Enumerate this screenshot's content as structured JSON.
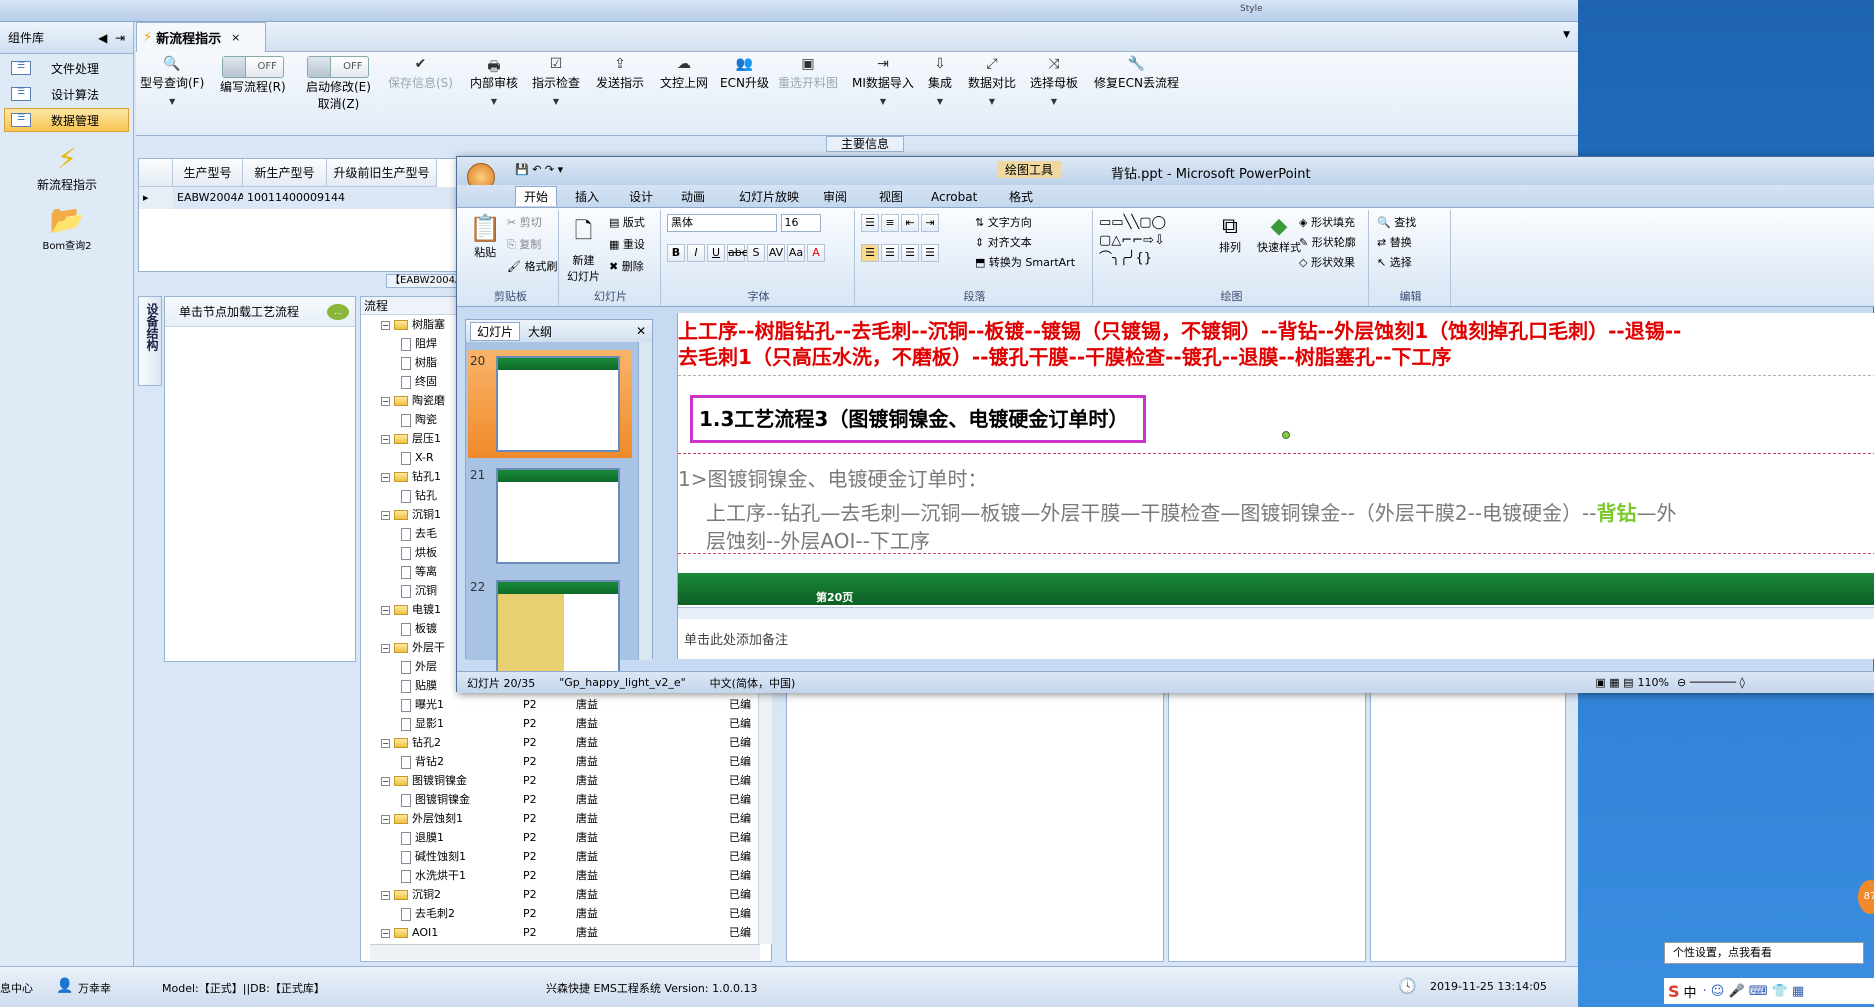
{
  "top": {
    "style_text": "Style"
  },
  "sidebar": {
    "title": "组件库",
    "items": [
      {
        "label": "文件处理"
      },
      {
        "label": "设计算法"
      },
      {
        "label": "数据管理"
      }
    ],
    "tools": [
      {
        "label": "新流程指示"
      },
      {
        "label": "Bom查询2"
      }
    ]
  },
  "doc_tab": {
    "label": "新流程指示"
  },
  "toolbar": {
    "items": [
      "型号查询(F)",
      "编写流程(R)",
      "启动修改(E)",
      "取消(Z)",
      "保存信息(S)",
      "内部审核",
      "指示检查",
      "发送指示",
      "文控上网",
      "ECN升级",
      "重选开料图",
      "MI数据导入",
      "集成",
      "数据对比",
      "选择母板",
      "修复ECN丢流程"
    ],
    "off": "OFF",
    "main_info": "主要信息"
  },
  "grid": {
    "headers": [
      "生产型号",
      "新生产型号",
      "升级前旧生产型号"
    ],
    "row": [
      "EABW2004A0",
      "10011400009144"
    ],
    "tag": "【EABW2004A"
  },
  "left_panels": {
    "vtab": "设备结构",
    "flow_hint": "单击节点加载工艺流程",
    "flow_header": "流程"
  },
  "tree": [
    {
      "lvl": 0,
      "type": "folder",
      "name": "树脂塞"
    },
    {
      "lvl": 1,
      "type": "doc",
      "name": "阻焊"
    },
    {
      "lvl": 1,
      "type": "doc",
      "name": "树脂"
    },
    {
      "lvl": 1,
      "type": "doc",
      "name": "终固"
    },
    {
      "lvl": 0,
      "type": "folder",
      "name": "陶瓷磨"
    },
    {
      "lvl": 1,
      "type": "doc",
      "name": "陶瓷"
    },
    {
      "lvl": 0,
      "type": "folder",
      "name": "层压1"
    },
    {
      "lvl": 1,
      "type": "doc",
      "name": "X-R"
    },
    {
      "lvl": 0,
      "type": "folder",
      "name": "钻孔1"
    },
    {
      "lvl": 1,
      "type": "doc",
      "name": "钻孔"
    },
    {
      "lvl": 0,
      "type": "folder",
      "name": "沉铜1"
    },
    {
      "lvl": 1,
      "type": "doc",
      "name": "去毛"
    },
    {
      "lvl": 1,
      "type": "doc",
      "name": "烘板"
    },
    {
      "lvl": 1,
      "type": "doc",
      "name": "等离"
    },
    {
      "lvl": 1,
      "type": "doc",
      "name": "沉铜"
    },
    {
      "lvl": 0,
      "type": "folder",
      "name": "电镀1"
    },
    {
      "lvl": 1,
      "type": "doc",
      "name": "板镀"
    },
    {
      "lvl": 0,
      "type": "folder",
      "name": "外层干"
    },
    {
      "lvl": 1,
      "type": "doc",
      "name": "外层"
    },
    {
      "lvl": 1,
      "type": "doc",
      "name": "贴膜"
    },
    {
      "lvl": 1,
      "type": "doc",
      "name": "曝光1",
      "c2": "P2",
      "c3": "唐益",
      "c4": "已编"
    },
    {
      "lvl": 1,
      "type": "doc",
      "name": "显影1",
      "c2": "P2",
      "c3": "唐益",
      "c4": "已编"
    },
    {
      "lvl": 0,
      "type": "folder",
      "name": "钻孔2",
      "c2": "P2",
      "c3": "唐益",
      "c4": "已编"
    },
    {
      "lvl": 1,
      "type": "doc",
      "name": "背钻2",
      "c2": "P2",
      "c3": "唐益",
      "c4": "已编"
    },
    {
      "lvl": 0,
      "type": "folder",
      "name": "图镀铜镍金",
      "c2": "P2",
      "c3": "唐益",
      "c4": "已编"
    },
    {
      "lvl": 1,
      "type": "doc",
      "name": "图镀铜镍金",
      "c2": "P2",
      "c3": "唐益",
      "c4": "已编"
    },
    {
      "lvl": 0,
      "type": "folder",
      "name": "外层蚀刻1",
      "c2": "P2",
      "c3": "唐益",
      "c4": "已编"
    },
    {
      "lvl": 1,
      "type": "doc",
      "name": "退膜1",
      "c2": "P2",
      "c3": "唐益",
      "c4": "已编"
    },
    {
      "lvl": 1,
      "type": "doc",
      "name": "碱性蚀刻1",
      "c2": "P2",
      "c3": "唐益",
      "c4": "已编"
    },
    {
      "lvl": 1,
      "type": "doc",
      "name": "水洗烘干1",
      "c2": "P2",
      "c3": "唐益",
      "c4": "已编"
    },
    {
      "lvl": 0,
      "type": "folder",
      "name": "沉铜2",
      "c2": "P2",
      "c3": "唐益",
      "c4": "已编"
    },
    {
      "lvl": 1,
      "type": "doc",
      "name": "去毛刺2",
      "c2": "P2",
      "c3": "唐益",
      "c4": "已编"
    },
    {
      "lvl": 0,
      "type": "folder",
      "name": "AOI1",
      "c2": "P2",
      "c3": "唐益",
      "c4": "已编"
    }
  ],
  "status": {
    "center": "息中心",
    "user": "万幸幸",
    "model": "Model:【正式】||DB:【正式库】",
    "system": "兴森快捷 EMS工程系统 Version: 1.0.0.13",
    "datetime": "2019-11-25 13:14:05"
  },
  "ppt": {
    "title": "背钻.ppt - Microsoft PowerPoint",
    "context_tab": "绘图工具",
    "tabs": [
      "开始",
      "插入",
      "设计",
      "动画",
      "幻灯片放映",
      "审阅",
      "视图",
      "Acrobat",
      "格式"
    ],
    "clipboard": {
      "paste": "粘贴",
      "cut": "剪切",
      "copy": "复制",
      "painter": "格式刷",
      "label": "剪贴板"
    },
    "slides": {
      "new": "新建",
      "new2": "幻灯片",
      "layout": "版式",
      "reset": "重设",
      "delete": "删除",
      "label": "幻灯片"
    },
    "font": {
      "name": "黑体",
      "size": "16",
      "label": "字体"
    },
    "para": {
      "dir": "文字方向",
      "align": "对齐文本",
      "smartart": "转换为 SmartArt",
      "label": "段落"
    },
    "draw": {
      "arrange": "排列",
      "quick": "快速样式",
      "fill": "形状填充",
      "outline": "形状轮廓",
      "effect": "形状效果",
      "label": "绘图"
    },
    "edit": {
      "find": "查找",
      "replace": "替换",
      "select": "选择",
      "label": "编辑"
    },
    "panel_tabs": [
      "幻灯片",
      "大纲"
    ],
    "thumbs": [
      "20",
      "21",
      "22"
    ],
    "slide": {
      "line1": "上工序--树脂钻孔--去毛刺--沉铜--板镀--镀锡（只镀锡，不镀铜）--背钻--外层蚀刻1（蚀刻掉孔口毛刺）--退锡--",
      "line2": "去毛刺1（只高压水洗，不磨板）--镀孔干膜--干膜检查--镀孔--退膜--树脂塞孔--下工序",
      "heading": "1.3工艺流程3（图镀铜镍金、电镀硬金订单时）",
      "sub": "1>图镀铜镍金、电镀硬金订单时：",
      "body1a": "上工序--钻孔—去毛刺—沉铜—板镀—外层干膜—干膜检查—图镀铜镍金--（外层干膜2--电镀硬金）--",
      "body1b": "背钻",
      "body1c": "—外",
      "body2": "层蚀刻--外层AOI--下工序",
      "footer": "第20页",
      "notes": "单击此处添加备注"
    },
    "status": {
      "slide": "幻灯片 20/35",
      "theme": "\"Gp_happy_light_v2_e\"",
      "lang": "中文(简体，中国)",
      "zoom": "110%"
    }
  },
  "tray": {
    "tip": "个性设置，点我看看",
    "ime": "中"
  }
}
